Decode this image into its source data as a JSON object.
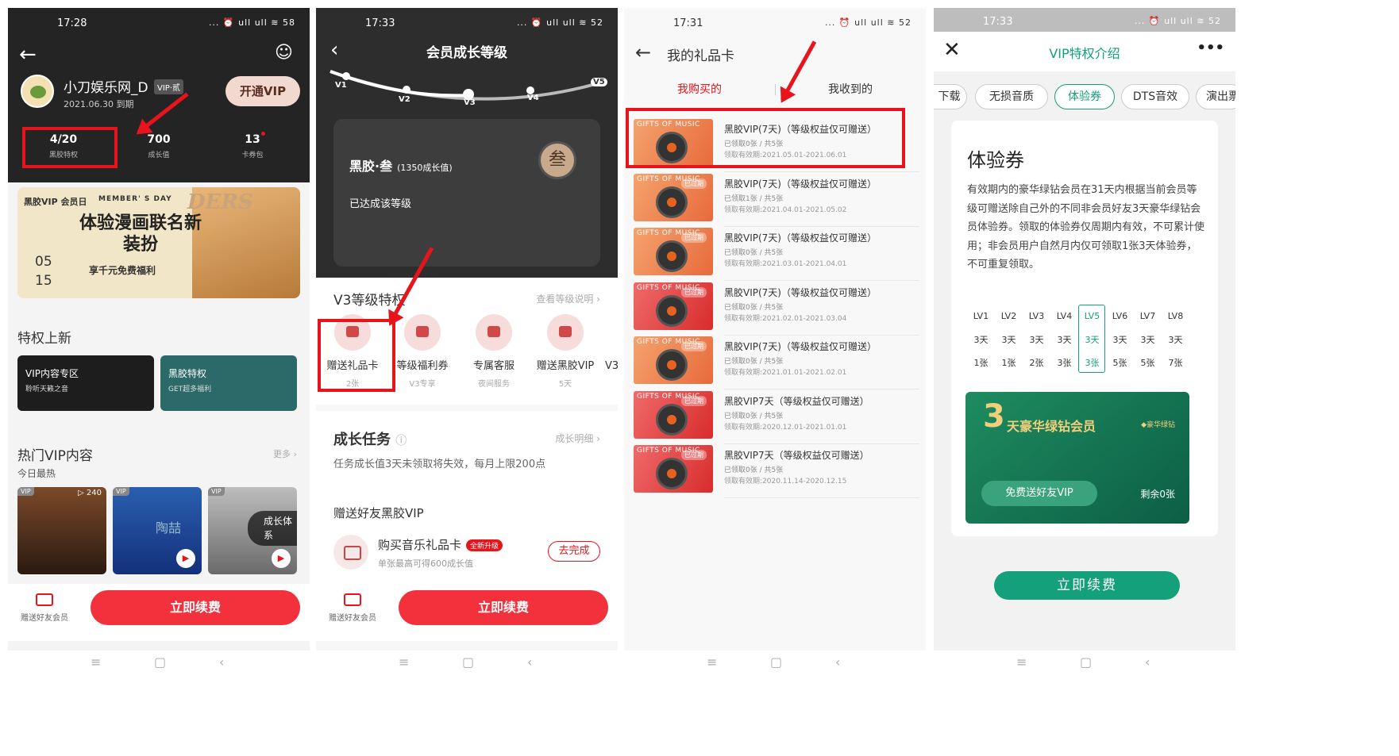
{
  "panel1": {
    "time": "17:28",
    "status_icons": "... ⏰ ull ull ≋ 58",
    "user_name": "小刀娱乐网_D",
    "vip_badge": "VIP·贰",
    "expire": "2021.06.30 到期",
    "open_vip": "开通VIP",
    "stats": [
      {
        "value": "4/20",
        "label": "黑胶特权"
      },
      {
        "value": "700",
        "label": "成长值"
      },
      {
        "value": "13",
        "label": "卡券包"
      }
    ],
    "banner": {
      "logo": "黑胶VIP 会员日",
      "member_day": "MEMBER' S DAY",
      "headline": "体验漫画联名新装扮",
      "sub": "享千元免费福利",
      "date_month": "05",
      "date_day": "15",
      "deco": "DERS"
    },
    "privilege_title": "特权上新",
    "cards": [
      {
        "title": "VIP内容专区",
        "sub": "聆听天籁之音"
      },
      {
        "title": "黑胶特权",
        "sub": "GET超多福利"
      }
    ],
    "hot_title": "热门VIP内容",
    "hot_sub": "今日最热",
    "more": "更多 ›",
    "thumbs": [
      {
        "tag": "VIP",
        "count": "▷ 240",
        "caption": ""
      },
      {
        "tag": "VIP",
        "count": "",
        "caption": "陶喆"
      },
      {
        "tag": "VIP",
        "count": "",
        "caption": "成长体系"
      }
    ],
    "gift_label": "赠送好友会员",
    "renew": "立即续费"
  },
  "panel2": {
    "time": "17:33",
    "status_icons": "... ⏰ ull ull ≋ 52",
    "title": "会员成长等级",
    "levels": [
      "V1",
      "V2",
      "V3",
      "V4",
      "V5"
    ],
    "level_name": "黑胶·叁",
    "level_value": "(1350成长值)",
    "reached": "已达成该等级",
    "medal": "叁",
    "priv_title": "V3等级特权",
    "priv_link": "查看等级说明 ›",
    "privileges": [
      {
        "name": "赠送礼品卡",
        "sub": "2张"
      },
      {
        "name": "等级福利券",
        "sub": "V3专享"
      },
      {
        "name": "专属客服",
        "sub": "夜间服务"
      },
      {
        "name": "赠送黑胶VIP",
        "sub": "5天"
      }
    ],
    "priv_more": "V3",
    "grow_title": "成长任务",
    "grow_link": "成长明细 ›",
    "grow_note": "任务成长值3天未领取将失效，每月上限200点",
    "gift_section": "赠送好友黑胶VIP",
    "task_name": "购买音乐礼品卡",
    "task_tag": "全新升级",
    "task_sub": "单张最高可得600成长值",
    "task_btn": "去完成",
    "gift_label": "赠送好友会员",
    "renew": "立即续费"
  },
  "panel3": {
    "time": "17:31",
    "status_icons": "... ⏰ ull ull ≋ 52",
    "title": "我的礼品卡",
    "tabs": [
      "我购买的",
      "我收到的"
    ],
    "card_label": "GIFTS OF MUSIC",
    "expired": "已过期",
    "cards": [
      {
        "title": "黑胶VIP(7天)（等级权益仅可赠送）",
        "sub": "已领取0张 / 共5张",
        "date": "领取有效期:2021.05.01-2021.06.01"
      },
      {
        "title": "黑胶VIP(7天)（等级权益仅可赠送）",
        "sub": "已领取1张 / 共5张",
        "date": "领取有效期:2021.04.01-2021.05.02"
      },
      {
        "title": "黑胶VIP(7天)（等级权益仅可赠送）",
        "sub": "已领取0张 / 共5张",
        "date": "领取有效期:2021.03.01-2021.04.01"
      },
      {
        "title": "黑胶VIP(7天)（等级权益仅可赠送）",
        "sub": "已领取0张 / 共5张",
        "date": "领取有效期:2021.02.01-2021.03.04"
      },
      {
        "title": "黑胶VIP(7天)（等级权益仅可赠送）",
        "sub": "已领取0张 / 共5张",
        "date": "领取有效期:2021.01.01-2021.02.01"
      },
      {
        "title": "黑胶VIP7天（等级权益仅可赠送）",
        "sub": "已领取0张 / 共5张",
        "date": "领取有效期:2020.12.01-2021.01.01"
      },
      {
        "title": "黑胶VIP7天（等级权益仅可赠送）",
        "sub": "已领取0张 / 共5张",
        "date": "领取有效期:2020.11.14-2020.12.15"
      }
    ]
  },
  "panel4": {
    "time": "17:33",
    "status_icons": "... ⏰ ull ull ≋ 52",
    "title": "VIP特权介绍",
    "chips": [
      "下载",
      "无损音质",
      "体验券",
      "DTS音效",
      "演出票"
    ],
    "heading": "体验券",
    "desc": "有效期内的豪华绿钻会员在31天内根据当前会员等级可赠送除自己外的不同非会员好友3天豪华绿钻会员体验券。领取的体验券仅周期内有效，不可累计使用；非会员用户自然月内仅可领取1张3天体验券，不可重复领取。",
    "table": {
      "levels": [
        "LV1",
        "LV2",
        "LV3",
        "LV4",
        "LV5",
        "LV6",
        "LV7",
        "LV8"
      ],
      "days": [
        "3天",
        "3天",
        "3天",
        "3天",
        "3天",
        "3天",
        "3天",
        "3天"
      ],
      "counts": [
        "1张",
        "1张",
        "2张",
        "3张",
        "3张",
        "5张",
        "5张",
        "7张"
      ]
    },
    "coupon": {
      "num": "3",
      "label": "天豪华绿钻会员",
      "brand": "◆豪华绿钻",
      "btn": "免费送好友VIP",
      "left": "剩余0张"
    },
    "renew": "立即续费"
  }
}
